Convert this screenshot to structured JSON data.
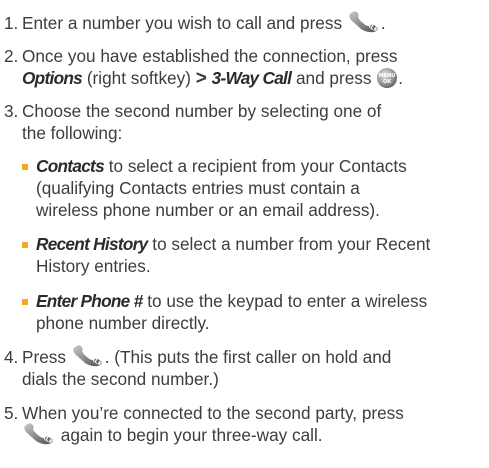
{
  "steps": [
    {
      "num": "1.",
      "text": "Enter a number you wish to call and press",
      "end": "."
    },
    {
      "num": "2.",
      "line1": "Once you have established the connection, press",
      "options": "Options",
      "softkey": "(right softkey)",
      "gt": ">",
      "threeway": "3-Way Call",
      "press": "and press",
      "end": "."
    },
    {
      "num": "3.",
      "line1": "Choose the second number by selecting one of",
      "line2": "the following:"
    },
    {
      "num": "4.",
      "press": "Press",
      "line1": ". (This puts the first caller on hold and",
      "line2": "dials the second number.)"
    },
    {
      "num": "5.",
      "line1": "When you’re connected to the second party, press",
      "line2": "again to begin your three-way call."
    }
  ],
  "options": [
    {
      "term": "Contacts",
      "line1": "to select a recipient from your Contacts",
      "line2": "(qualifying Contacts entries must contain a",
      "line3": "wireless phone number or an email address)."
    },
    {
      "term": "Recent History",
      "line1": "to select a number from your Recent",
      "line2": "History entries."
    },
    {
      "term": "Enter Phone #",
      "line1": "to use the keypad to enter a wireless",
      "line2": "phone number directly."
    }
  ],
  "icons": {
    "talk_key": "talk-key-icon",
    "menu_ok_key": "menu-ok-key-icon",
    "talk_label": "TALK",
    "menu_label": "MENU",
    "ok_label": "OK"
  },
  "colors": {
    "text": "#3d3d3d",
    "bullet": "#f5a623",
    "key_body": "#8a8a8a"
  }
}
